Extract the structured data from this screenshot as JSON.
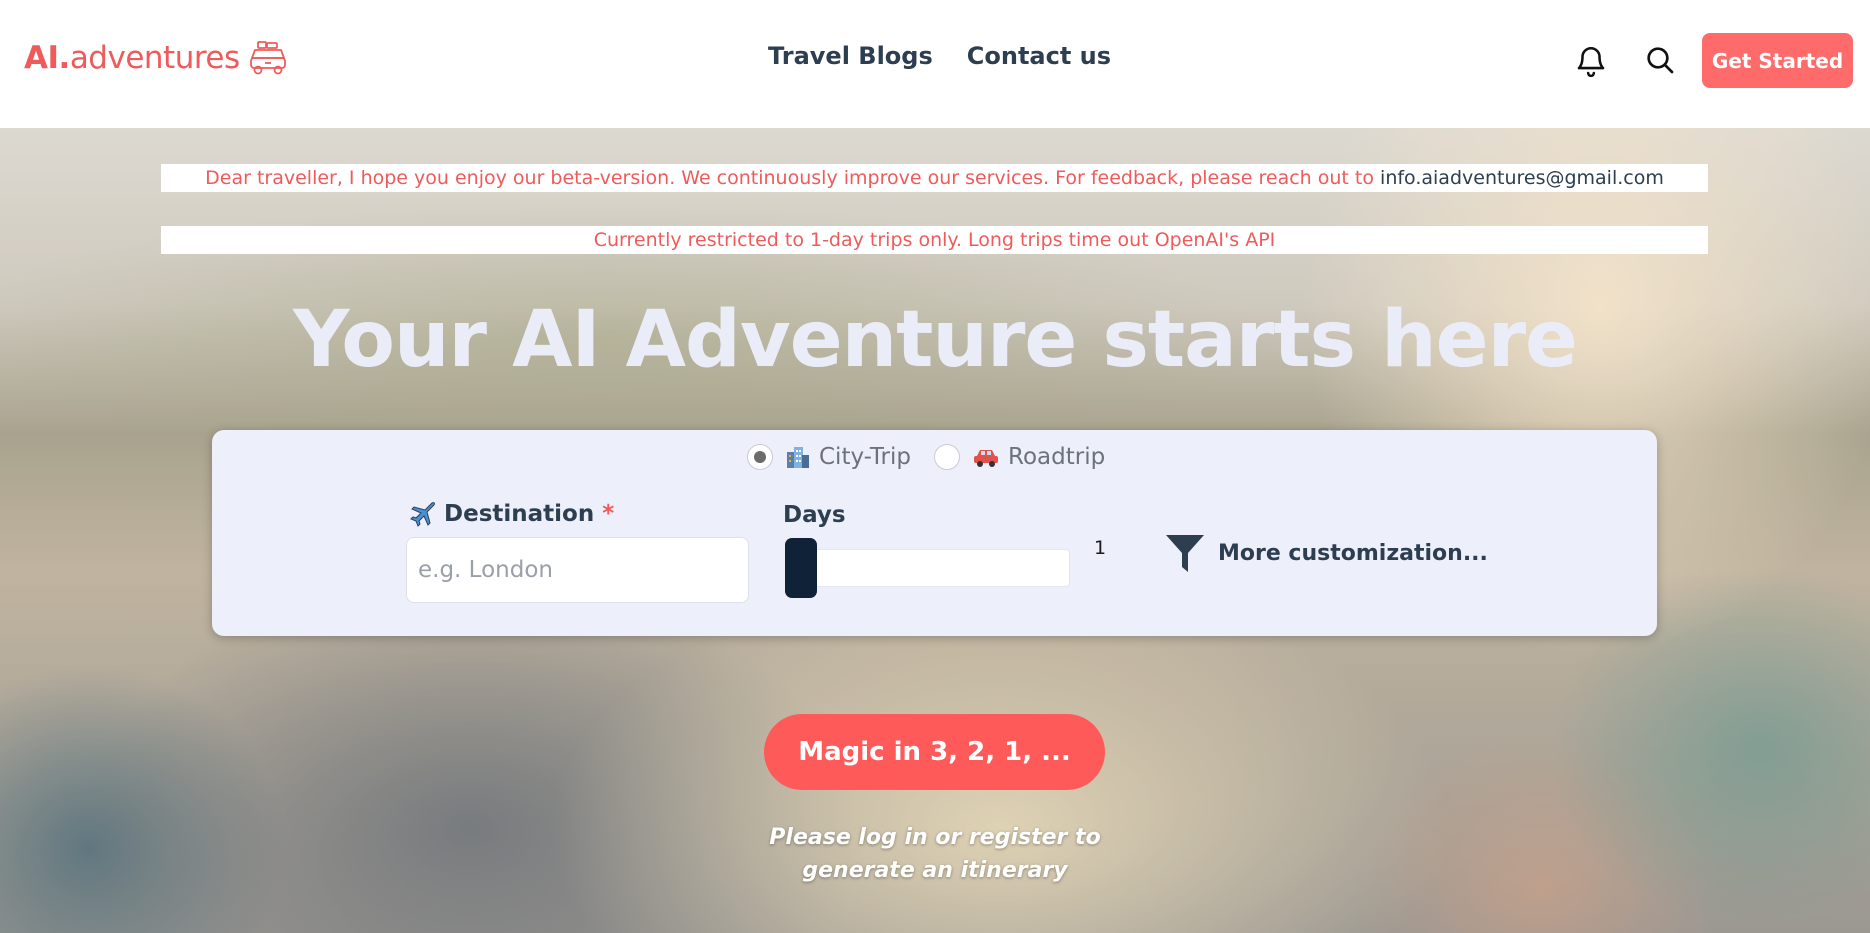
{
  "header": {
    "logo_bold": "AI.",
    "logo_rest": "adventures",
    "logo_icon": "car-with-luggage-icon",
    "nav": [
      {
        "label": "Travel Blogs"
      },
      {
        "label": "Contact us"
      }
    ],
    "bell_icon": "bell-icon",
    "search_icon": "search-icon",
    "cta_label": "Get Started",
    "accent_color": "#ff6b6b"
  },
  "notices": {
    "feedback_text": "Dear traveller, I hope you enjoy our beta-version. We continuously improve our services. For feedback, please reach out to ",
    "feedback_email": "info.aiadventures@gmail.com",
    "restriction_text": "Currently restricted to 1-day trips only. Long trips time out OpenAI's API"
  },
  "hero": {
    "title": "Your AI Adventure starts here"
  },
  "form": {
    "trip_types": [
      {
        "label": "City-Trip",
        "icon": "city-buildings-icon",
        "selected": true
      },
      {
        "label": "Roadtrip",
        "icon": "car-icon",
        "selected": false
      }
    ],
    "destination_label": "Destination",
    "destination_required_mark": "*",
    "destination_placeholder": "e.g. London",
    "destination_value": "",
    "days_label": "Days",
    "days_value": "1",
    "more_label": "More customization..."
  },
  "actions": {
    "magic_label": "Magic in 3, 2, 1, ...",
    "login_note_line1": "Please log in or register to",
    "login_note_line2": "generate an itinerary"
  }
}
